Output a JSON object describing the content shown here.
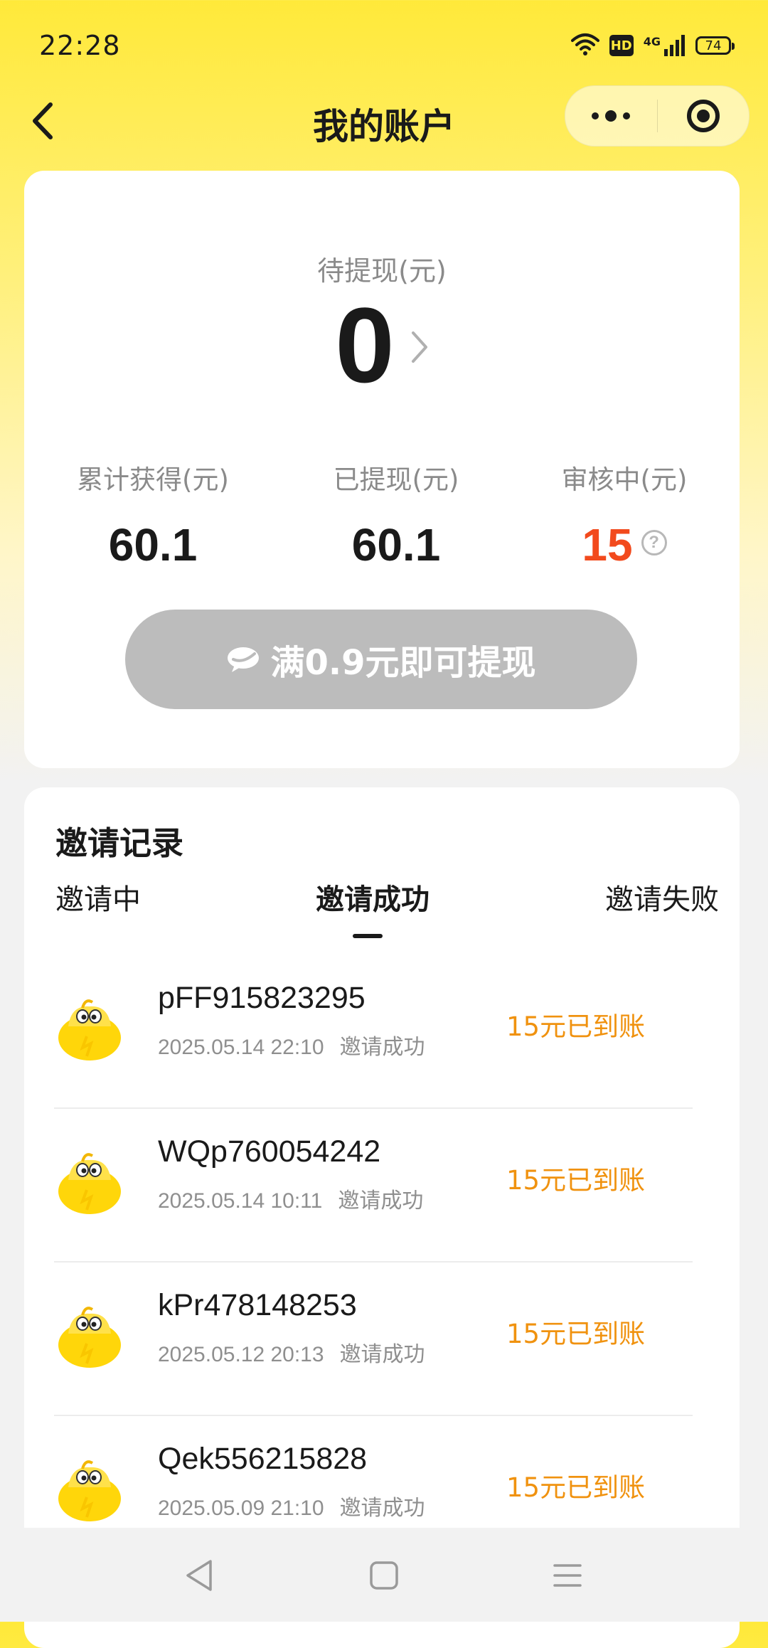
{
  "status_bar": {
    "time": "22:28",
    "hd": "HD",
    "network": "4G",
    "battery": "74"
  },
  "nav": {
    "title": "我的账户"
  },
  "account": {
    "pending_label": "待提现(元)",
    "pending_amount": "0",
    "stats": [
      {
        "label": "累计获得(元)",
        "value": "60.1"
      },
      {
        "label": "已提现(元)",
        "value": "60.1"
      },
      {
        "label": "审核中(元)",
        "value": "15"
      }
    ],
    "help_icon_glyph": "?",
    "withdraw_button_label": "满0.9元即可提现"
  },
  "invite": {
    "title": "邀请记录",
    "tabs": [
      "邀请中",
      "邀请成功",
      "邀请失败"
    ],
    "active_tab": 1,
    "records": [
      {
        "name": "pFF915823295",
        "date": "2025.05.14 22:10",
        "meta_status": "邀请成功",
        "status": "15元已到账"
      },
      {
        "name": "WQp760054242",
        "date": "2025.05.14 10:11",
        "meta_status": "邀请成功",
        "status": "15元已到账"
      },
      {
        "name": "kPr478148253",
        "date": "2025.05.12 20:13",
        "meta_status": "邀请成功",
        "status": "15元已到账"
      },
      {
        "name": "Qek556215828",
        "date": "2025.05.09 21:10",
        "meta_status": "邀请成功",
        "status": "15元已到账"
      }
    ]
  },
  "colors": {
    "accent_yellow": "#ffe93a",
    "red_value": "#f24a1d",
    "orange_status": "#f0920f",
    "disabled_button": "#bcbcbc"
  }
}
